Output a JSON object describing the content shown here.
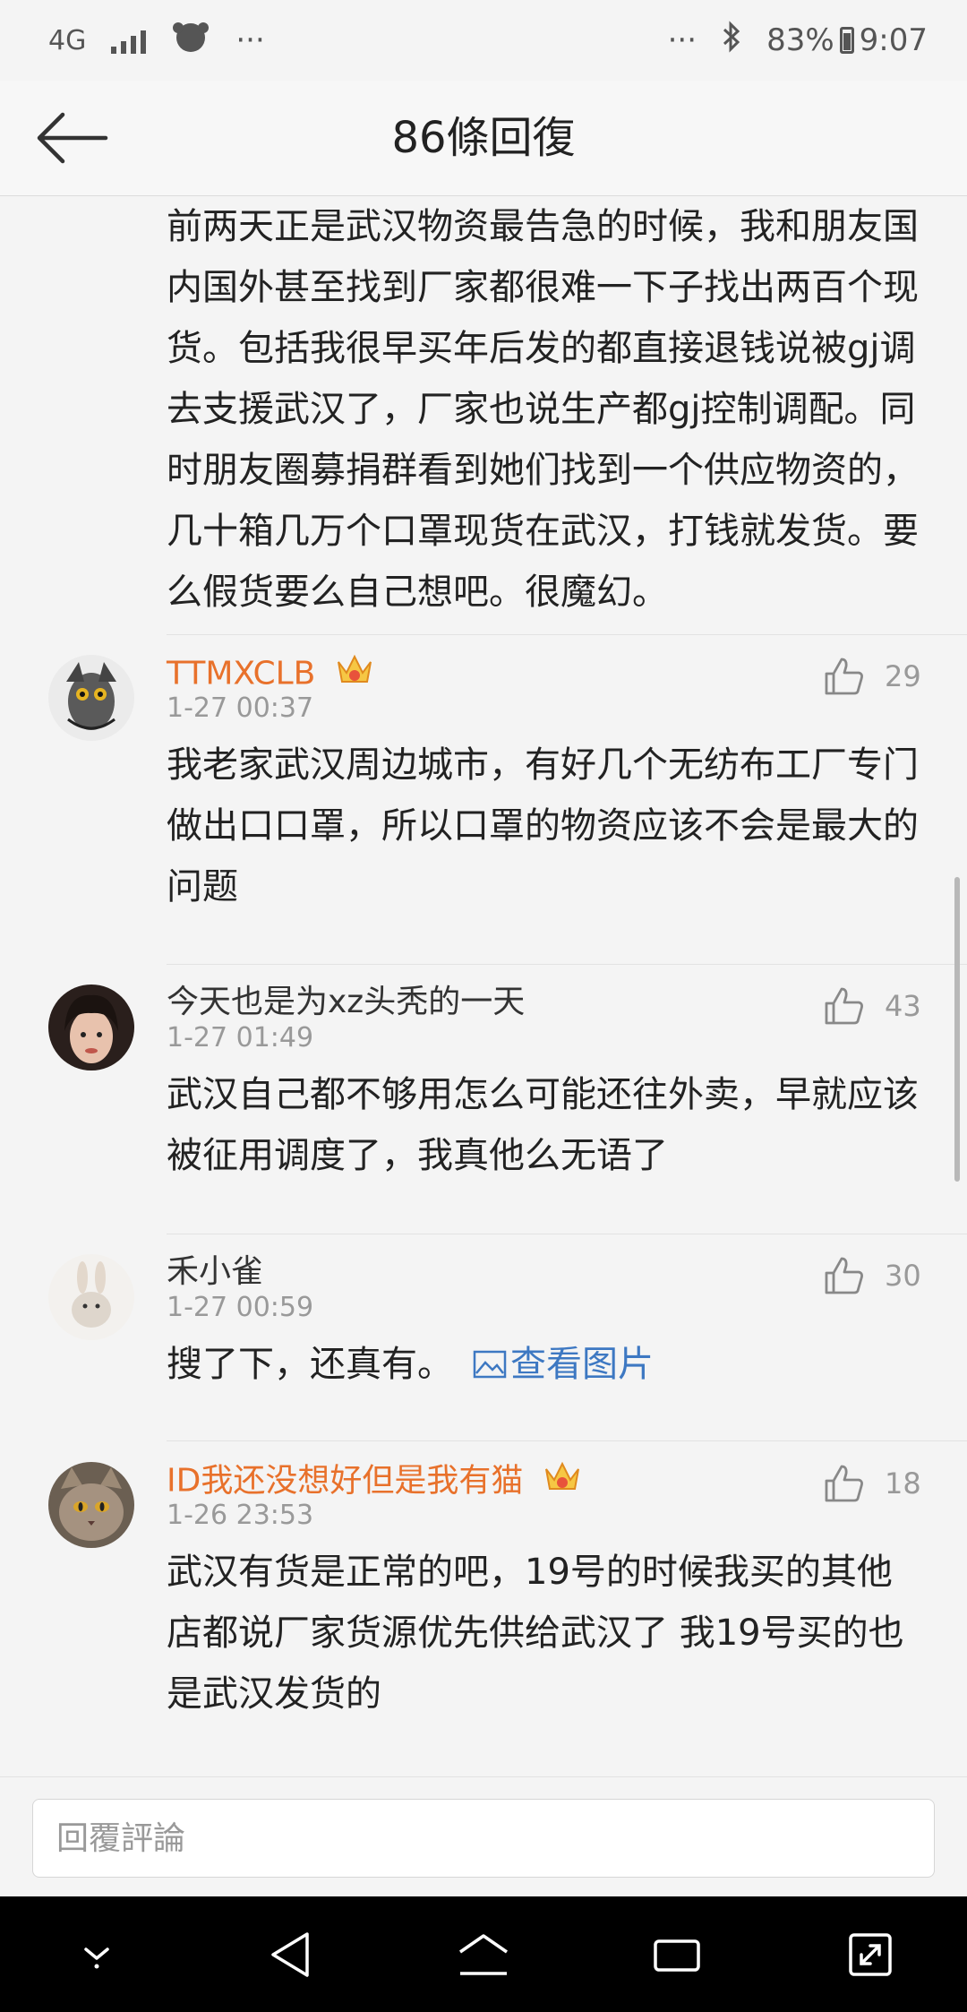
{
  "status_bar": {
    "network": "4G",
    "dots_left": "···",
    "dots_right": "···",
    "battery": "83%",
    "time": "9:07"
  },
  "header": {
    "title": "86條回復",
    "back_icon": "back-arrow-icon"
  },
  "feed": {
    "continued_text": "前两天正是武汉物资最告急的时候，我和朋友国内国外甚至找到厂家都很难一下子找出两百个现货。包括我很早买年后发的都直接退钱说被gj调去支援武汉了，厂家也说生产都gj控制调配。同时朋友圈募捐群看到她们找到一个供应物资的，几十箱几万个口罩现货在武汉，打钱就发货。要么假货要么自己想吧。很魔幻。",
    "comments": [
      {
        "username": "TTMXCLB",
        "vip": true,
        "time": "1-27 00:37",
        "likes": "29",
        "text": "我老家武汉周边城市，有好几个无纺布工厂专门做出口口罩，所以口罩的物资应该不会是最大的问题"
      },
      {
        "username": "今天也是为xz头秃的一天",
        "vip": false,
        "time": "1-27 01:49",
        "likes": "43",
        "text": "武汉自己都不够用怎么可能还往外卖，早就应该被征用调度了，我真他么无语了"
      },
      {
        "username": "禾小雀",
        "vip": false,
        "time": "1-27 00:59",
        "likes": "30",
        "text": "搜了下，还真有。",
        "link": "查看图片"
      },
      {
        "username": "ID我还没想好但是我有猫",
        "vip": true,
        "time": "1-26 23:53",
        "likes": "18",
        "text": "武汉有货是正常的吧，19号的时候我买的其他店都说厂家货源优先供给武汉了 我19号买的也是武汉发货的"
      }
    ]
  },
  "reply_bar": {
    "placeholder": "回覆評論"
  },
  "colors": {
    "vip_name": "#e8712b",
    "link": "#3d78c2",
    "muted": "#999999"
  }
}
